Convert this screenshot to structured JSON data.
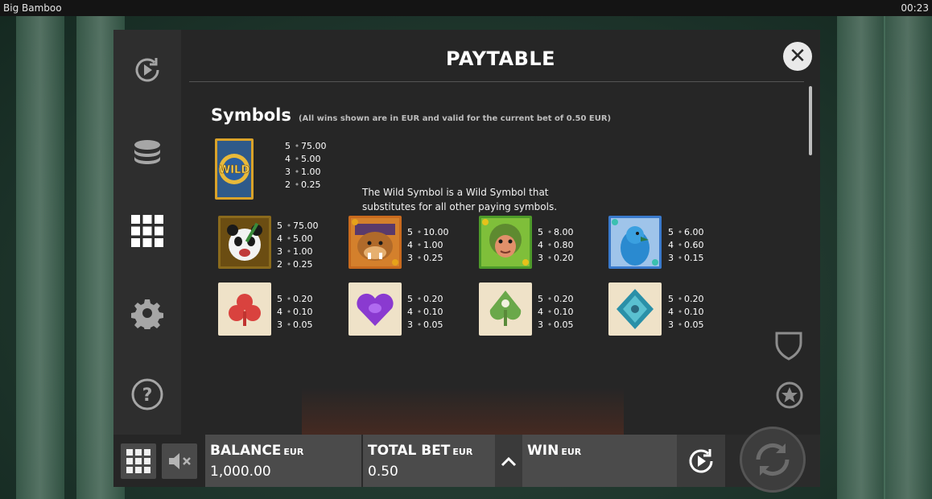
{
  "window": {
    "title": "Big Bamboo",
    "clock": "00:23"
  },
  "paytable": {
    "title": "PAYTABLE",
    "section_title": "Symbols",
    "section_note": "(All wins shown are in EUR and valid for the current bet of 0.50 EUR)",
    "wild": {
      "label": "WILD",
      "pays": [
        {
          "count": "5",
          "value": "75.00"
        },
        {
          "count": "4",
          "value": "5.00"
        },
        {
          "count": "3",
          "value": "1.00"
        },
        {
          "count": "2",
          "value": "0.25"
        }
      ],
      "description": "The Wild Symbol is a Wild Symbol that substitutes for all other paying symbols."
    },
    "symbols": [
      {
        "name": "panda",
        "pays": [
          {
            "count": "5",
            "value": "75.00"
          },
          {
            "count": "4",
            "value": "5.00"
          },
          {
            "count": "3",
            "value": "1.00"
          },
          {
            "count": "2",
            "value": "0.25"
          }
        ]
      },
      {
        "name": "bear",
        "pays": [
          {
            "count": "5",
            "value": "10.00"
          },
          {
            "count": "4",
            "value": "1.00"
          },
          {
            "count": "3",
            "value": "0.25"
          }
        ]
      },
      {
        "name": "monkey",
        "pays": [
          {
            "count": "5",
            "value": "8.00"
          },
          {
            "count": "4",
            "value": "0.80"
          },
          {
            "count": "3",
            "value": "0.20"
          }
        ]
      },
      {
        "name": "bird",
        "pays": [
          {
            "count": "5",
            "value": "6.00"
          },
          {
            "count": "4",
            "value": "0.60"
          },
          {
            "count": "3",
            "value": "0.15"
          }
        ]
      },
      {
        "name": "club",
        "pays": [
          {
            "count": "5",
            "value": "0.20"
          },
          {
            "count": "4",
            "value": "0.10"
          },
          {
            "count": "3",
            "value": "0.05"
          }
        ]
      },
      {
        "name": "heart",
        "pays": [
          {
            "count": "5",
            "value": "0.20"
          },
          {
            "count": "4",
            "value": "0.10"
          },
          {
            "count": "3",
            "value": "0.05"
          }
        ]
      },
      {
        "name": "spade",
        "pays": [
          {
            "count": "5",
            "value": "0.20"
          },
          {
            "count": "4",
            "value": "0.10"
          },
          {
            "count": "3",
            "value": "0.05"
          }
        ]
      },
      {
        "name": "diamond",
        "pays": [
          {
            "count": "5",
            "value": "0.20"
          },
          {
            "count": "4",
            "value": "0.10"
          },
          {
            "count": "3",
            "value": "0.05"
          }
        ]
      }
    ]
  },
  "bottom_bar": {
    "balance": {
      "label": "BALANCE",
      "currency": "EUR",
      "value": "1,000.00"
    },
    "total_bet": {
      "label": "TOTAL BET",
      "currency": "EUR",
      "value": "0.50"
    },
    "win": {
      "label": "WIN",
      "currency": "EUR",
      "value": ""
    }
  },
  "colors": {
    "panel": "#262626",
    "rail": "#2e2e2e",
    "bar": "#4b4b4b",
    "accent_text": "#ffffff"
  },
  "icons": [
    "autoplay-icon",
    "coins-icon",
    "grid-menu-icon",
    "settings-icon",
    "help-icon",
    "close-icon",
    "shield-icon",
    "star-icon",
    "mute-icon",
    "chevron-up-icon",
    "spin-icon"
  ]
}
